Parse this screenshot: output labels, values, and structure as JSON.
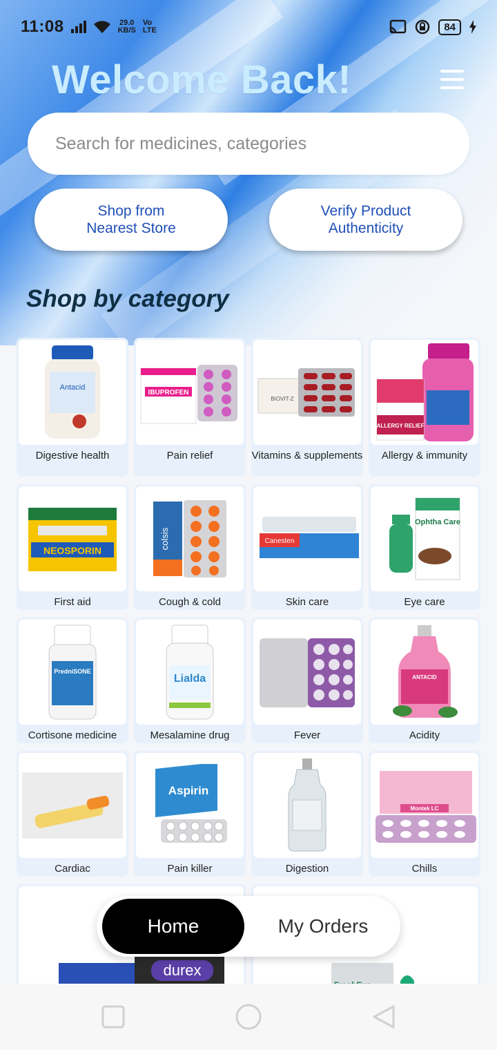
{
  "status_bar": {
    "time": "11:08",
    "net_speed_value": "29.0",
    "net_speed_unit": "KB/S",
    "volte_top": "Vo",
    "volte_bottom": "LTE",
    "battery": "84"
  },
  "header": {
    "title": "Welcome Back!"
  },
  "search": {
    "placeholder": "Search for medicines, categories"
  },
  "actions": {
    "nearest_store_line1": "Shop from",
    "nearest_store_line2": "Nearest Store",
    "verify_line1": "Verify Product",
    "verify_line2": "Authenticity"
  },
  "section": {
    "title": "Shop by category"
  },
  "categories": [
    {
      "label": "Digestive health",
      "product_text": "Antacid"
    },
    {
      "label": "Pain relief",
      "product_text": "IBUPROFEN"
    },
    {
      "label": "Vitamins & supplements",
      "product_text": "BIOVIT-Z"
    },
    {
      "label": "Allergy & immunity",
      "product_text": "ALLERGY RELIEF"
    },
    {
      "label": "First aid",
      "product_text": "NEOSPORIN"
    },
    {
      "label": "Cough & cold",
      "product_text": "colsis"
    },
    {
      "label": "Skin care",
      "product_text": "Canesten"
    },
    {
      "label": "Eye care",
      "product_text": "Ophtha Care"
    },
    {
      "label": "Cortisone medicine",
      "product_text": "PredniSONE"
    },
    {
      "label": "Mesalamine drug",
      "product_text": "Lialda"
    },
    {
      "label": "Fever",
      "product_text": ""
    },
    {
      "label": "Acidity",
      "product_text": "ANTACID"
    },
    {
      "label": "Cardiac",
      "product_text": ""
    },
    {
      "label": "Pain killer",
      "product_text": "Aspirin"
    },
    {
      "label": "Digestion",
      "product_text": ""
    },
    {
      "label": "Chills",
      "product_text": "Montek LC"
    }
  ],
  "partial_cards": [
    {
      "product_text": "durex"
    },
    {
      "product_text": "FreshEye"
    }
  ],
  "bottom_nav": {
    "home": "Home",
    "orders": "My Orders"
  },
  "colors": {
    "accent_blue": "#1f4fb8",
    "title_color": "#c9ecff",
    "card_bg": "#e8f1fb"
  }
}
